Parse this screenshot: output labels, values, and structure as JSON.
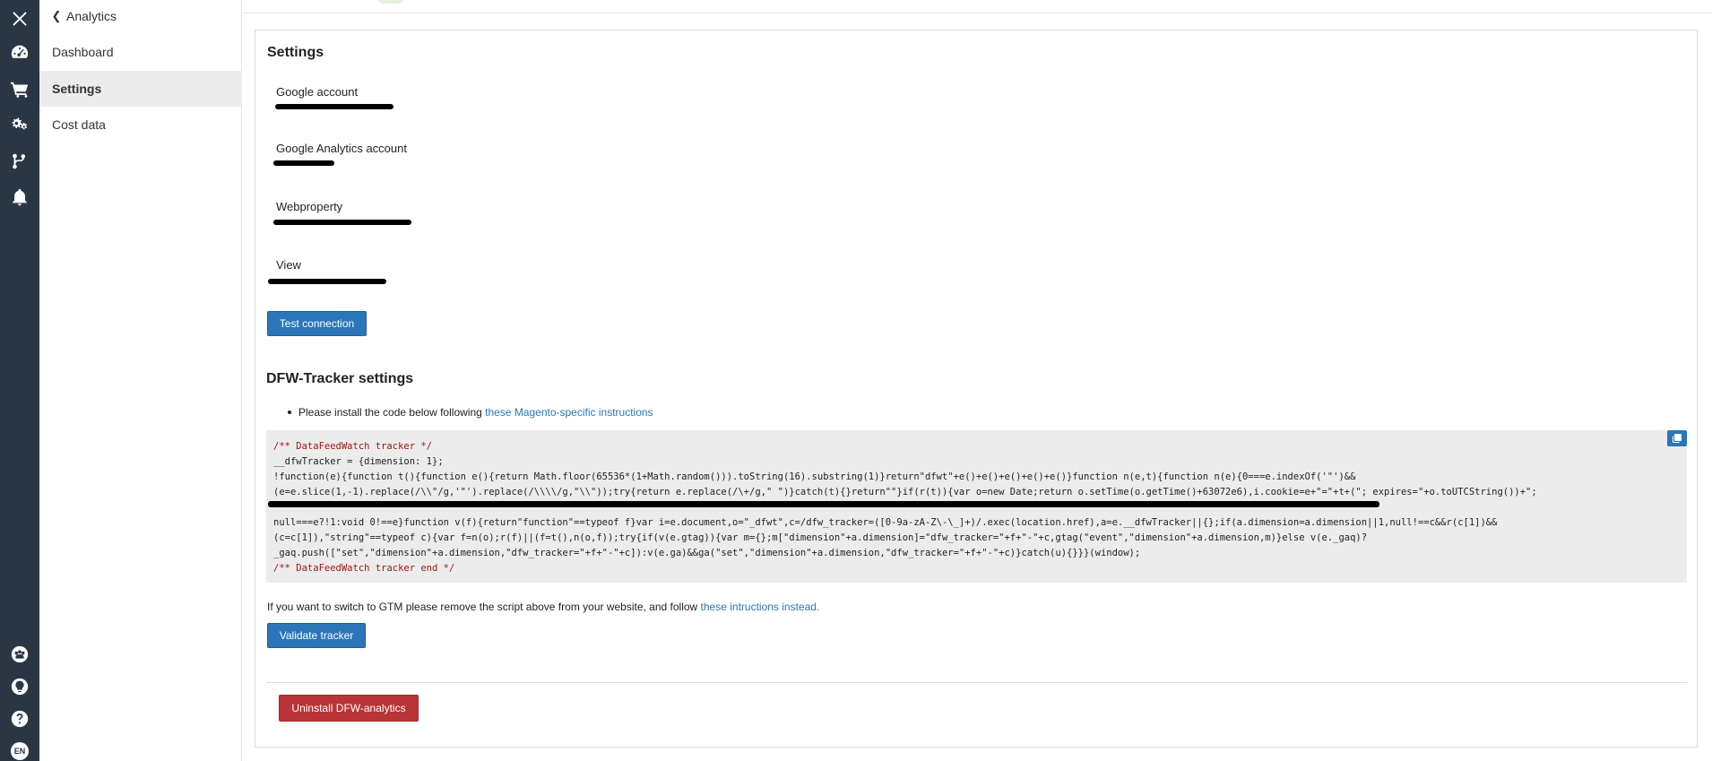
{
  "sidebar": {
    "back_label": "Analytics",
    "items": [
      {
        "label": "Dashboard"
      },
      {
        "label": "Settings"
      },
      {
        "label": "Cost data"
      }
    ]
  },
  "rail": {
    "icons": [
      "close-icon",
      "dashboard-icon",
      "cart-icon",
      "gears-icon",
      "branch-icon",
      "bell-icon",
      "support-icon",
      "lightbulb-icon",
      "help-icon",
      "language-icon"
    ],
    "language": "EN"
  },
  "settings": {
    "title": "Settings",
    "fields": [
      {
        "label": "Google account"
      },
      {
        "label": "Google Analytics account"
      },
      {
        "label": "Webproperty"
      },
      {
        "label": "View"
      }
    ],
    "test_button": "Test connection"
  },
  "tracker": {
    "title": "DFW-Tracker settings",
    "instruction_text": "Please install the code below following ",
    "instruction_link": "these Magento-specific instructions",
    "code": {
      "line1": "/** DataFeedWatch tracker */",
      "line2": "__dfwTracker = {dimension: 1};",
      "line3": "!function(e){function t(){function e(){return Math.floor(65536*(1+Math.random())).toString(16).substring(1)}return\"dfwt\"+e()+e()+e()+e()+e()}function n(e,t){function n(e){0===e.indexOf('\"')&&",
      "line4": "(e=e.slice(1,-1).replace(/\\\\\"/g,'\"').replace(/\\\\\\\\/g,\"\\\\\"));try{return e.replace(/\\+/g,\" \")}catch(t){}return\"\"}if(r(t)){var o=new Date;return o.setTime(o.getTime()+63072e6),i.cookie=e+\"=\"+t+(\"; expires=\"+o.toUTCString())+\";",
      "line6": "null===e?!1:void 0!==e}function v(f){return\"function\"==typeof f}var i=e.document,o=\"_dfwt\",c=/dfw_tracker=([0-9a-zA-Z\\-\\_]+)/.exec(location.href),a=e.__dfwTracker||{};if(a.dimension=a.dimension||1,null!==c&&r(c[1])&&",
      "line7": "(c=c[1]),\"string\"==typeof c){var f=n(o);r(f)||(f=t(),n(o,f));try{if(v(e.gtag)){var m={};m[\"dimension\"+a.dimension]=\"dfw_tracker=\"+f+\"-\"+c,gtag(\"event\",\"dimension\"+a.dimension,m)}else v(e._gaq)?",
      "line8": "_gaq.push([\"set\",\"dimension\"+a.dimension,\"dfw_tracker=\"+f+\"-\"+c]):v(e.ga)&&ga(\"set\",\"dimension\"+a.dimension,\"dfw_tracker=\"+f+\"-\"+c)}catch(u){}}}(window);",
      "line9": "/** DataFeedWatch tracker end */"
    },
    "gtm_text": "If you want to switch to GTM please remove the script above from your website, and follow ",
    "gtm_link": "these intructions instead.",
    "validate_button": "Validate tracker"
  },
  "uninstall_button": "Uninstall DFW-analytics",
  "colors": {
    "rail": "#2b3645",
    "primary": "#2b76b9",
    "danger": "#b83436",
    "code_bg": "#ececec"
  }
}
